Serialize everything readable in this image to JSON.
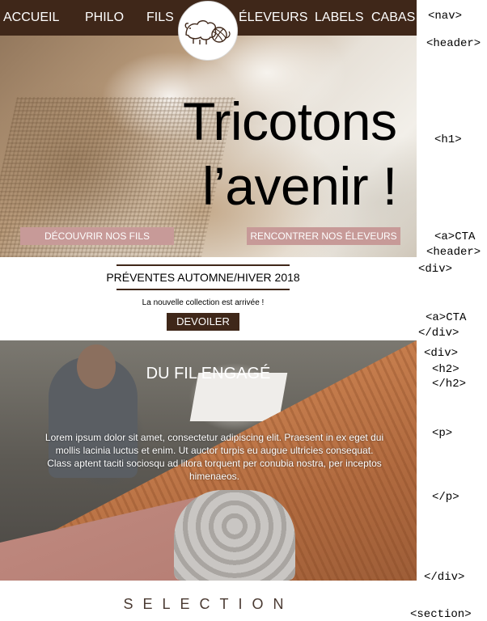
{
  "nav": {
    "items": [
      "ACCUEIL",
      "PHILO",
      "FILS",
      "ÉLEVEURS",
      "LABELS",
      "CABAS"
    ]
  },
  "hero": {
    "headline_line1": "Tricotons",
    "headline_line2": "l’avenir !",
    "cta_left": "DÉCOUVRIR NOS FILS",
    "cta_right": "RENCONTRER NOS ÉLEVEURS"
  },
  "preventes": {
    "title": "PRÉVENTES AUTOMNE/HIVER 2018",
    "text": "La nouvelle collection est arrivée !",
    "button": "DEVOILER"
  },
  "engage": {
    "title": "DU FIL ENGAGÉ",
    "body": "Lorem ipsum dolor sit amet, consectetur adipiscing elit. Praesent in ex eget dui mollis lacinia luctus et enim. Ut auctor turpis eu augue ultricies consequat. Class aptent taciti sociosqu ad litora torquent per conubia nostra, per inceptos himenaeos."
  },
  "selection": {
    "title": "SELECTION"
  },
  "annotations": {
    "nav": "<nav>",
    "header_open": "<header>",
    "h1": "<h1>",
    "cta1": "<a>CTA",
    "header_close": "<header>",
    "div1_open": "<div>",
    "cta2": "<a>CTA",
    "div1_close": "</div>",
    "div2_open": "<div>",
    "h2_open": "<h2>",
    "h2_close": "</h2>",
    "p_open": "<p>",
    "p_close": "</p>",
    "div2_close": "</div>",
    "section": "<section>"
  },
  "colors": {
    "brand_brown": "#3f2719",
    "cta_pink": "#c79a98"
  },
  "icons": {
    "logo": "sheep-yarn-logo-icon"
  }
}
